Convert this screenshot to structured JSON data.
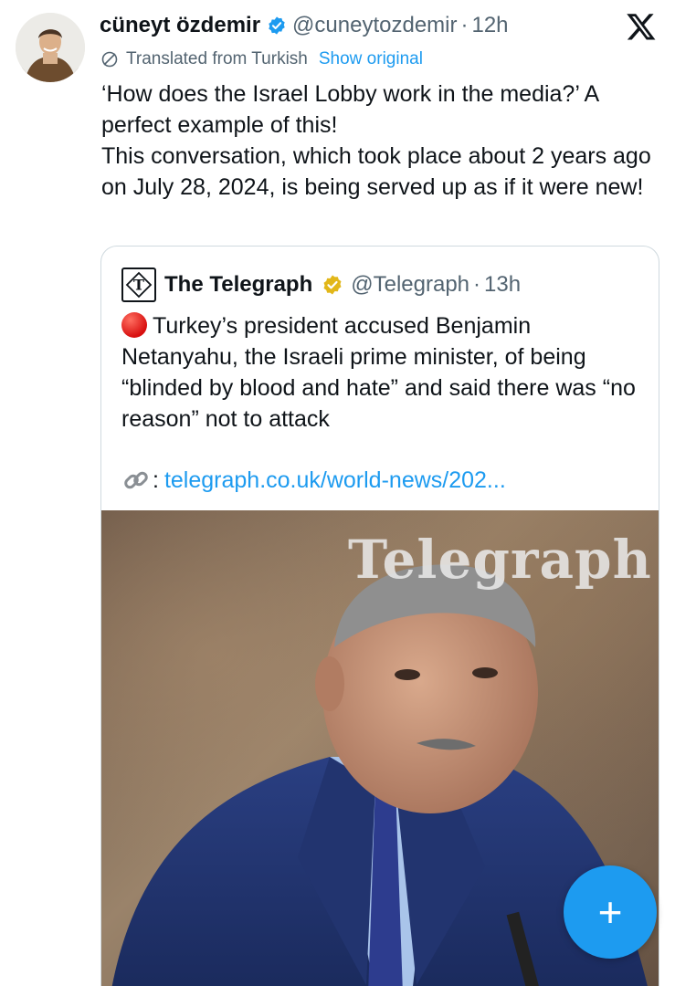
{
  "tweet": {
    "author": {
      "name": "cüneyt özdemir",
      "handle": "@cuneytozdemir",
      "separator": "·",
      "time": "12h",
      "avatar_icon": "avatar-photo"
    },
    "platform_icon": "x-logo-icon",
    "translation": {
      "label": "Translated from Turkish",
      "action": "Show original"
    },
    "text_lines": [
      "‘How does the Israel Lobby work in the media?’ A perfect example of this!",
      "This conversation, which took place about 2 years ago on July 28, 2024, is being served up as if it were new!"
    ]
  },
  "quote": {
    "name": "The Telegraph",
    "handle": "@Telegraph",
    "separator": "·",
    "time": "13h",
    "logo_icon": "telegraph-logo-icon",
    "text": "Turkey’s president accused Benjamin Netanyahu, the Israeli prime minister, of being “blinded by blood and hate” and said there was “no reason” not to attack",
    "link_colon": ":",
    "link_url": "telegraph.co.uk/world-news/202...",
    "image_watermark": "Telegraph"
  },
  "fab": {
    "label": "+",
    "icon": "compose-plus-icon"
  },
  "colors": {
    "accent": "#1d9bf0",
    "text": "#0f1419",
    "secondary": "#536471",
    "verified_blue": "#1d9bf0",
    "verified_gold": "#e2b719"
  }
}
